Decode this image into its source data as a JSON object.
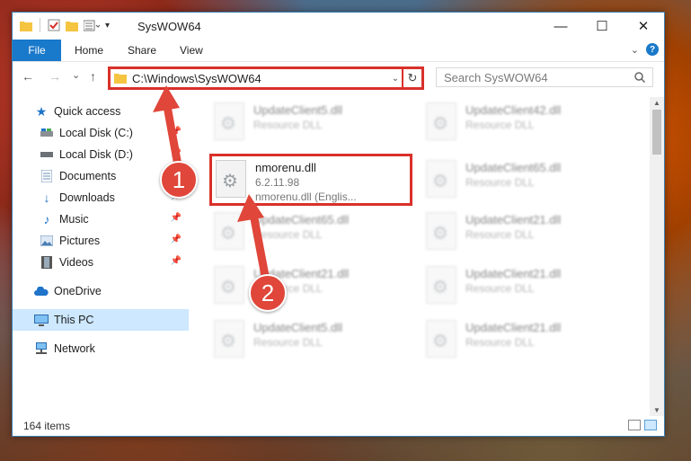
{
  "window": {
    "title": "SysWOW64",
    "controls": {
      "minimize": "—",
      "maximize": "☐",
      "close": "✕"
    }
  },
  "ribbon": {
    "file": "File",
    "tabs": [
      "Home",
      "Share",
      "View"
    ]
  },
  "navigation": {
    "back": "←",
    "forward": "→",
    "recent": "⌄",
    "up": "↑",
    "address": "C:\\Windows\\SysWOW64",
    "search_placeholder": "Search SysWOW64"
  },
  "sidebar": {
    "items": [
      {
        "label": "Quick access",
        "icon": "star-icon"
      },
      {
        "label": "Local Disk (C:)",
        "icon": "drive-icon",
        "pinned": true
      },
      {
        "label": "Local Disk (D:)",
        "icon": "drive-icon",
        "pinned": true
      },
      {
        "label": "Documents",
        "icon": "documents-icon",
        "pinned": true
      },
      {
        "label": "Downloads",
        "icon": "downloads-icon",
        "pinned": true
      },
      {
        "label": "Music",
        "icon": "music-icon",
        "pinned": true
      },
      {
        "label": "Pictures",
        "icon": "pictures-icon",
        "pinned": true
      },
      {
        "label": "Videos",
        "icon": "videos-icon",
        "pinned": true
      },
      {
        "label": "OneDrive",
        "icon": "cloud-icon"
      },
      {
        "label": "This PC",
        "icon": "computer-icon",
        "selected": true
      },
      {
        "label": "Network",
        "icon": "network-icon"
      }
    ]
  },
  "files": [
    {
      "name": "UpdateClient5.dll",
      "line1": "Resource DLL",
      "line2": ""
    },
    {
      "name": "UpdateClient42.dll",
      "line1": "Resource DLL",
      "line2": ""
    },
    {
      "name": "nmorenu.dll",
      "line1": "6.2.11.98",
      "line2": "nmorenu.dll (Englis..."
    },
    {
      "name": "UpdateClient65.dll",
      "line1": "Resource DLL",
      "line2": ""
    },
    {
      "name": "UpdateClient65.dll",
      "line1": "Resource DLL",
      "line2": ""
    },
    {
      "name": "UpdateClient21.dll",
      "line1": "Resource DLL",
      "line2": ""
    },
    {
      "name": "UpdateClient21.dll",
      "line1": "Resource DLL",
      "line2": ""
    },
    {
      "name": "UpdateClient21.dll",
      "line1": "Resource DLL",
      "line2": ""
    },
    {
      "name": "UpdateClient5.dll",
      "line1": "Resource DLL",
      "line2": ""
    },
    {
      "name": "UpdateClient21.dll",
      "line1": "Resource DLL",
      "line2": ""
    }
  ],
  "status": {
    "count": "164 items"
  },
  "annotations": {
    "step1": "1",
    "step2": "2",
    "color": "#e0463a"
  }
}
